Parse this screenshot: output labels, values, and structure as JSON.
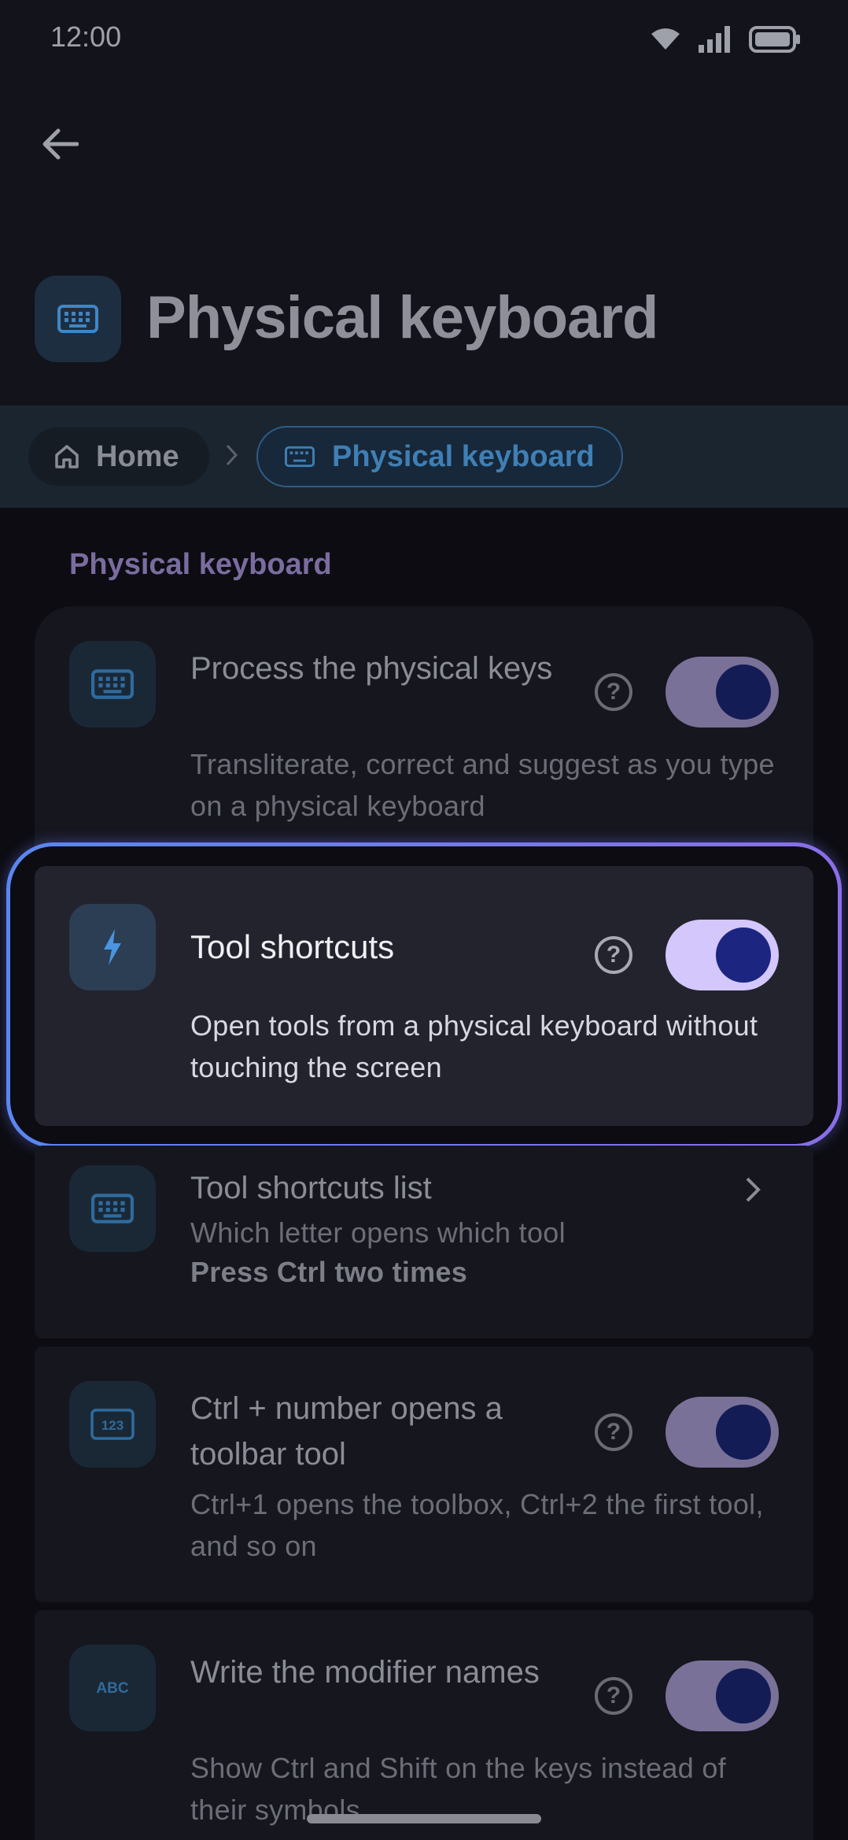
{
  "status_bar": {
    "time": "12:00"
  },
  "header": {
    "title": "Physical keyboard"
  },
  "breadcrumb": {
    "home": "Home",
    "current": "Physical keyboard"
  },
  "section": {
    "title": "Physical keyboard"
  },
  "settings": [
    {
      "title": "Process the physical keys",
      "description": "Transliterate, correct and suggest as you type on a physical keyboard",
      "toggle": true,
      "icon": "keyboard-icon"
    },
    {
      "title": "Tool shortcuts",
      "description": "Open tools from a physical keyboard without touching the screen",
      "toggle": true,
      "icon": "bolt-icon"
    },
    {
      "title": "Tool shortcuts list",
      "description": "Which letter opens which tool",
      "note": "Press Ctrl two times",
      "icon": "keyboard-icon"
    },
    {
      "title": "Ctrl + number opens a toolbar tool",
      "description": "Ctrl+1 opens the toolbox, Ctrl+2 the first tool, and so on",
      "toggle": true,
      "icon": "123-icon"
    },
    {
      "title": "Write the modifier names",
      "description": "Show Ctrl and Shift on the keys instead of their symbols",
      "toggle": true,
      "icon": "abc-icon"
    }
  ],
  "colors": {
    "highlight_start": "#5a86f0",
    "highlight_end": "#8a6ee8",
    "toggle_on": "#d3c7fb",
    "accent_blue": "#3f7fb4"
  }
}
